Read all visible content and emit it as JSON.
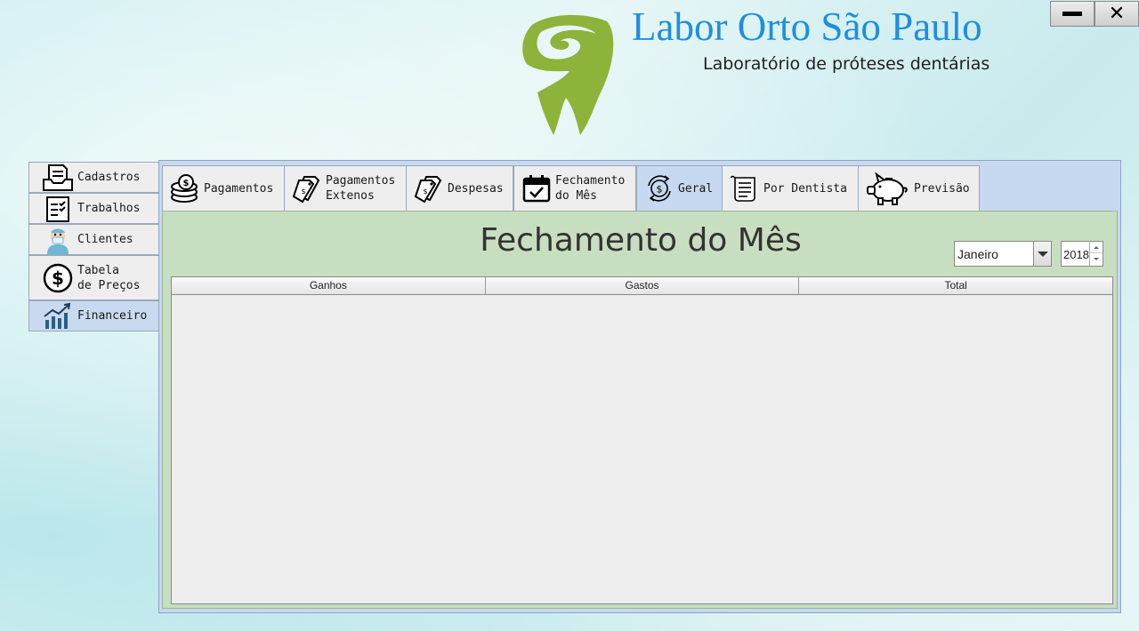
{
  "header": {
    "title": "Labor Orto São Paulo",
    "subtitle": "Laboratório de próteses dentárias",
    "logo_icon": "tooth-logo-icon",
    "brand_color": "#1e8fe0",
    "logo_color": "#8db33a"
  },
  "window_controls": {
    "minimize_icon": "minimize-icon",
    "close_label": "✕"
  },
  "sidebar": {
    "items": [
      {
        "label": "Cadastros",
        "icon": "document-tray-icon"
      },
      {
        "label": "Trabalhos",
        "icon": "checklist-icon"
      },
      {
        "label": "Clientes",
        "icon": "dentist-icon"
      },
      {
        "label": "Tabela\nde Preços",
        "icon": "dollar-circle-icon"
      },
      {
        "label": "Financeiro",
        "icon": "chart-growth-icon",
        "active": true
      }
    ]
  },
  "tabs": [
    {
      "label": "Pagamentos",
      "icon": "coins-icon"
    },
    {
      "label": "Pagamentos\nExtenos",
      "icon": "price-tags-icon"
    },
    {
      "label": "Despesas",
      "icon": "price-tags-icon"
    },
    {
      "label": "Fechamento\ndo Mês",
      "icon": "calendar-check-icon"
    },
    {
      "label": "Geral",
      "icon": "dollar-cycle-icon",
      "active": true
    },
    {
      "label": "Por Dentista",
      "icon": "receipt-icon"
    },
    {
      "label": "Previsão",
      "icon": "piggy-bank-icon"
    }
  ],
  "content": {
    "heading": "Fechamento do Mês",
    "month_select": "Janeiro",
    "year": "2018",
    "table": {
      "columns": [
        "Ganhos",
        "Gastos",
        "Total"
      ],
      "rows": []
    }
  },
  "colors": {
    "panel": "#c6d9f0",
    "content_bg": "#c8dec0",
    "table_bg": "#eeeeee"
  }
}
